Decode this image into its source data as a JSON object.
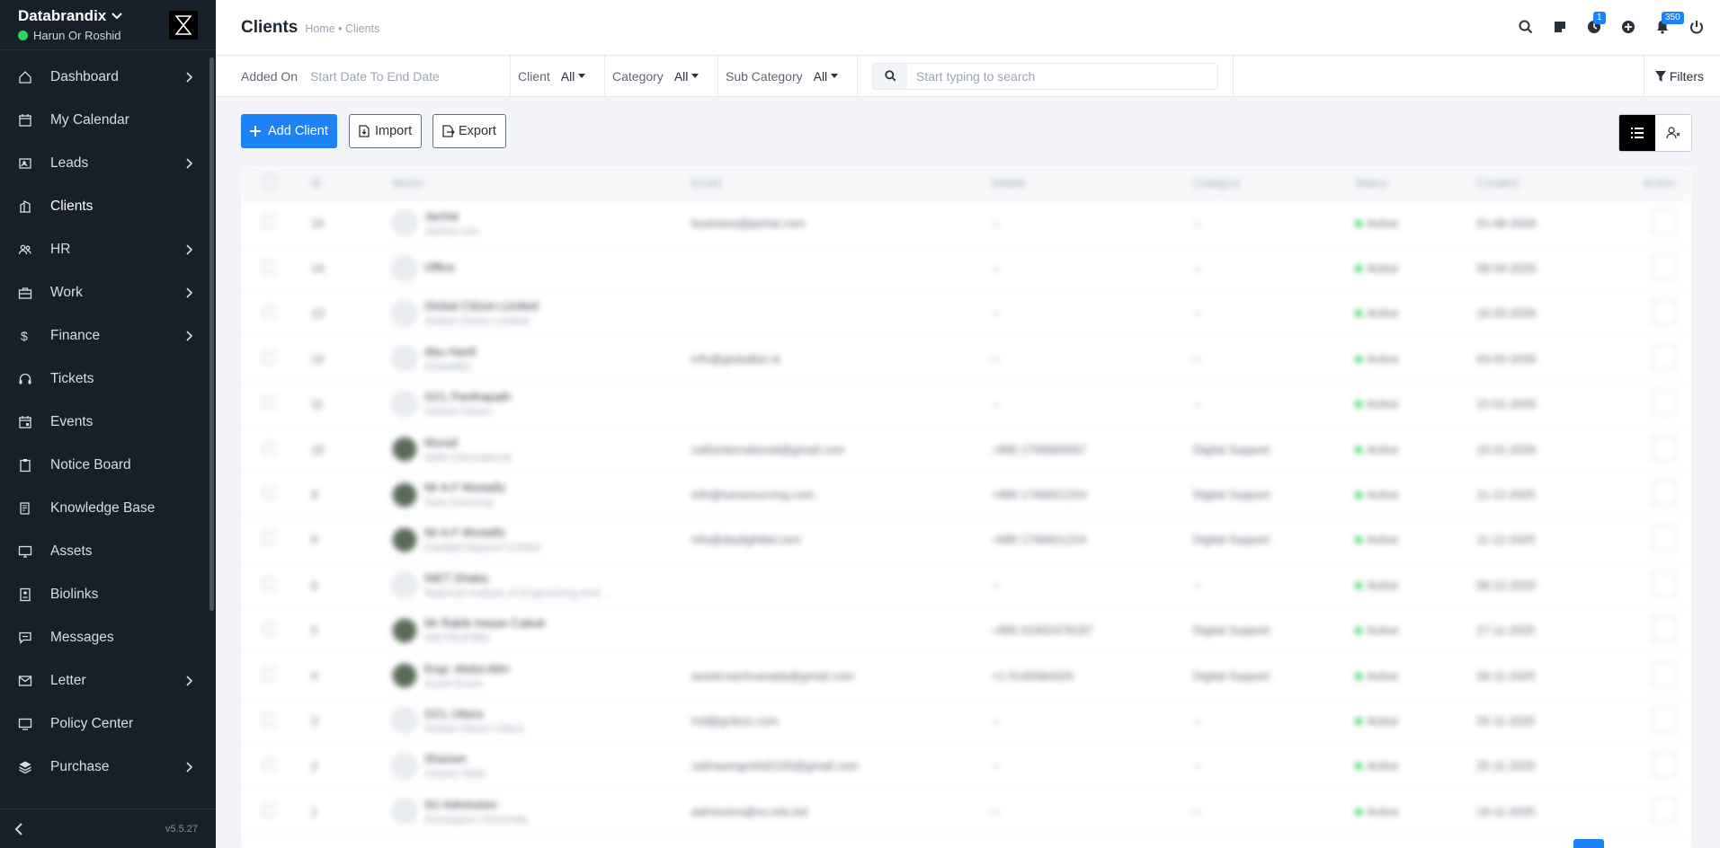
{
  "brand": {
    "name": "Databrandix",
    "user": "Harun Or Roshid"
  },
  "sidebar": {
    "items": [
      {
        "label": "Dashboard",
        "icon": "home-icon",
        "chevron": true
      },
      {
        "label": "My Calendar",
        "icon": "calendar-icon",
        "chevron": false
      },
      {
        "label": "Leads",
        "icon": "leads-icon",
        "chevron": true
      },
      {
        "label": "Clients",
        "icon": "building-icon",
        "chevron": false,
        "active": true
      },
      {
        "label": "HR",
        "icon": "people-icon",
        "chevron": true
      },
      {
        "label": "Work",
        "icon": "briefcase-icon",
        "chevron": true
      },
      {
        "label": "Finance",
        "icon": "dollar-icon",
        "chevron": true
      },
      {
        "label": "Tickets",
        "icon": "headset-icon",
        "chevron": false
      },
      {
        "label": "Events",
        "icon": "calendar-event-icon",
        "chevron": false
      },
      {
        "label": "Notice Board",
        "icon": "clipboard-icon",
        "chevron": false
      },
      {
        "label": "Knowledge Base",
        "icon": "book-icon",
        "chevron": false
      },
      {
        "label": "Assets",
        "icon": "monitor-icon",
        "chevron": false
      },
      {
        "label": "Biolinks",
        "icon": "link-card-icon",
        "chevron": false
      },
      {
        "label": "Messages",
        "icon": "chat-icon",
        "chevron": false
      },
      {
        "label": "Letter",
        "icon": "envelope-icon",
        "chevron": true
      },
      {
        "label": "Policy Center",
        "icon": "display-icon",
        "chevron": false
      },
      {
        "label": "Purchase",
        "icon": "layers-icon",
        "chevron": true
      }
    ],
    "version": "v5.5.27"
  },
  "header": {
    "title": "Clients",
    "breadcrumb": "Home • Clients",
    "timer_badge": "1",
    "notification_badge": "350"
  },
  "filters": {
    "added_on_label": "Added On",
    "date_placeholder": "Start Date To End Date",
    "client_label": "Client",
    "client_value": "All",
    "category_label": "Category",
    "category_value": "All",
    "subcategory_label": "Sub Category",
    "subcategory_value": "All",
    "search_placeholder": "Start typing to search",
    "filters_label": "Filters"
  },
  "actions": {
    "add_client": "Add Client",
    "import": "Import",
    "export": "Export"
  },
  "table": {
    "columns": [
      "Id",
      "Name",
      "Email",
      "Mobile",
      "Category",
      "Status",
      "Created",
      "Action"
    ],
    "rows": [
      {
        "id": "15",
        "name": "Jachai",
        "sub": "Jachai.com",
        "email": "business@jachai.com",
        "mobile": "--",
        "category": "--",
        "status": "Active",
        "created": "01-08-2026"
      },
      {
        "id": "14",
        "name": "Office",
        "sub": "",
        "email": "",
        "mobile": "--",
        "category": "--",
        "status": "Active",
        "created": "08-04-2026"
      },
      {
        "id": "13",
        "name": "Global Citizen Limited",
        "sub": "Global Citizen Limited",
        "email": "",
        "mobile": "--",
        "category": "--",
        "status": "Active",
        "created": "16-03-2026"
      },
      {
        "id": "12",
        "name": "Abu Hanif",
        "sub": "GlobalBiz",
        "email": "info@globalbiz.ie",
        "mobile": "--",
        "category": "--",
        "status": "Active",
        "created": "03-02-2026"
      },
      {
        "id": "11",
        "name": "GCL Panthapath",
        "sub": "Global Citizen",
        "email": "",
        "mobile": "--",
        "category": "--",
        "status": "Active",
        "created": "15-01-2026"
      },
      {
        "id": "10",
        "name": "Murad",
        "sub": "Nafis International",
        "email": "nafisinternational@gmail.com",
        "mobile": "+880 1799660067",
        "category": "Digital Support",
        "status": "Active",
        "created": "10-01-2026"
      },
      {
        "id": "9",
        "name": "Mr A.F Mostafiz",
        "sub": "Sara Sourcing",
        "email": "info@sarasourcing.com",
        "mobile": "+880 1766621224",
        "category": "Digital Support",
        "status": "Active",
        "created": "11-12-2025"
      },
      {
        "id": "8",
        "name": "Mr A.F Mostafiz",
        "sub": "Daylight Apparel Limited",
        "email": "info@daylightbd.com",
        "mobile": "+880 1766621224",
        "category": "Digital Support",
        "status": "Active",
        "created": "11-12-2025"
      },
      {
        "id": "6",
        "name": "NIET Dhaka",
        "sub": "National Institute of Engineering And ...",
        "email": "",
        "mobile": "--",
        "category": "--",
        "status": "Active",
        "created": "08-12-2025"
      },
      {
        "id": "5",
        "name": "Mr Rakib Hasan Cabuk",
        "sub": "NIETRUFIBN",
        "email": "",
        "mobile": "+880 01902478187",
        "category": "Digital Support",
        "status": "Active",
        "created": "27-11-2025"
      },
      {
        "id": "4",
        "name": "Engr. Abdul Alim",
        "sub": "Asset Event",
        "email": "assetcoachcanada@gmail.com",
        "mobile": "+1 5145584329",
        "category": "Digital Support",
        "status": "Active",
        "created": "26-11-2025"
      },
      {
        "id": "3",
        "name": "GCL Uttara",
        "sub": "Global Citizen Uttara",
        "email": "md@gclexs.com",
        "mobile": "--",
        "category": "--",
        "status": "Active",
        "created": "25-11-2025"
      },
      {
        "id": "2",
        "name": "Shaown",
        "sub": "Classic Nails",
        "email": "salmasmgrshd2105@gmail.com",
        "mobile": "--",
        "category": "--",
        "status": "Active",
        "created": "25-11-2025"
      },
      {
        "id": "1",
        "name": "SU Admission",
        "sub": "Sonargaon University",
        "email": "admission@su.edu.bd",
        "mobile": "--",
        "category": "--",
        "status": "Active",
        "created": "19-11-2025"
      }
    ]
  }
}
